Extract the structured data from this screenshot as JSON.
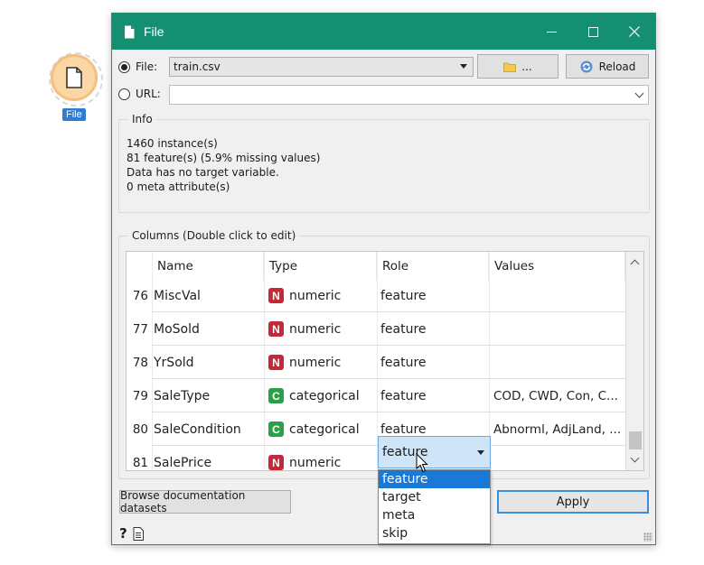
{
  "canvas_widget": {
    "label": "File"
  },
  "window": {
    "title": "File",
    "controls": {
      "minimize": "minimize",
      "maximize": "maximize",
      "close": "close"
    }
  },
  "source": {
    "file_label": "File:",
    "file_value": "train.csv",
    "browse_label": "...",
    "reload_label": "Reload",
    "url_label": "URL:",
    "url_value": ""
  },
  "info": {
    "title": "Info",
    "lines": [
      "1460 instance(s)",
      "81 feature(s) (5.9% missing values)",
      "Data has no target variable.",
      "0 meta attribute(s)"
    ]
  },
  "columns": {
    "title": "Columns (Double click to edit)",
    "headers": [
      "Name",
      "Type",
      "Role",
      "Values"
    ],
    "rows": [
      {
        "idx": "76",
        "name": "MiscVal",
        "type_badge": "N",
        "type": "numeric",
        "role": "feature",
        "values": ""
      },
      {
        "idx": "77",
        "name": "MoSold",
        "type_badge": "N",
        "type": "numeric",
        "role": "feature",
        "values": ""
      },
      {
        "idx": "78",
        "name": "YrSold",
        "type_badge": "N",
        "type": "numeric",
        "role": "feature",
        "values": ""
      },
      {
        "idx": "79",
        "name": "SaleType",
        "type_badge": "C",
        "type": "categorical",
        "role": "feature",
        "values": "COD, CWD, Con, C..."
      },
      {
        "idx": "80",
        "name": "SaleCondition",
        "type_badge": "C",
        "type": "categorical",
        "role": "feature",
        "values": "Abnorml, AdjLand, ..."
      },
      {
        "idx": "81",
        "name": "SalePrice",
        "type_badge": "N",
        "type": "numeric",
        "role": "",
        "values": ""
      }
    ]
  },
  "role_editor": {
    "current": "feature",
    "options": [
      "feature",
      "target",
      "meta",
      "skip"
    ],
    "selected_index": 0
  },
  "footer": {
    "browse_docs_label": "Browse documentation datasets",
    "apply_label": "Apply",
    "help_icon": "help-icon",
    "report_icon": "report-icon"
  },
  "colors": {
    "titlebar": "#148f72",
    "numeric_badge": "#c52839",
    "categorical_badge": "#2aa04a",
    "selection": "#1a78d6"
  }
}
